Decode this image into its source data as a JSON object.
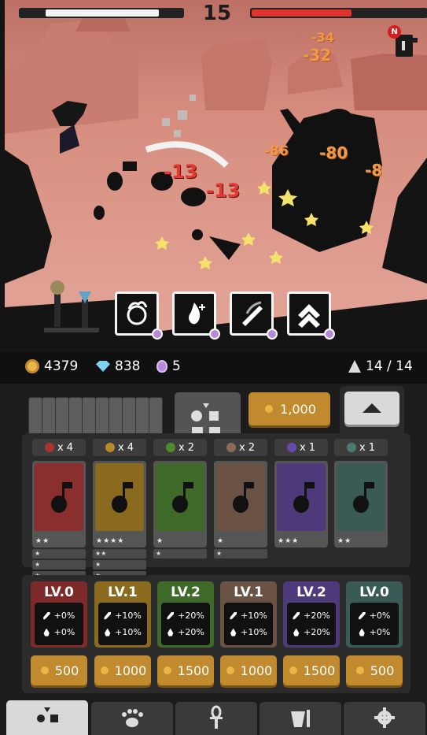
{
  "hud": {
    "wave_number": "15",
    "notification_badge": "N",
    "player_hp_fraction": 0.83,
    "enemy_hp_fraction": 0.57
  },
  "damage_numbers": [
    "-32",
    "-34",
    "-8",
    "-13",
    "-13",
    "-80"
  ],
  "skills": [
    {
      "icon": "fireball-icon"
    },
    {
      "icon": "flame-plus-icon"
    },
    {
      "icon": "sword-slash-icon"
    },
    {
      "icon": "double-arrow-up-icon"
    }
  ],
  "resources": {
    "gold": "4379",
    "gems": "838",
    "potions": "5",
    "population": "14 / 14"
  },
  "summon": {
    "buy_label": "1,000"
  },
  "units": [
    {
      "count": "x 4",
      "color": "#8a2e2e",
      "mark_color": "#a33",
      "stars": "★★",
      "extra_cards": [
        "★",
        "★",
        "★"
      ]
    },
    {
      "count": "x 4",
      "color": "#8a6a1e",
      "mark_color": "#b48a2a",
      "stars": "★★★★",
      "extra_cards": [
        "★★",
        "★",
        "★"
      ]
    },
    {
      "count": "x 2",
      "color": "#3f6a2a",
      "mark_color": "#4f8a2c",
      "stars": "★",
      "extra_cards": [
        "★"
      ]
    },
    {
      "count": "x 2",
      "color": "#6a5244",
      "mark_color": "#8a6a55",
      "stars": "★",
      "extra_cards": [
        "★"
      ]
    },
    {
      "count": "x 1",
      "color": "#4e3a7a",
      "mark_color": "#6a4aa8",
      "stars": "★★★",
      "extra_cards": []
    },
    {
      "count": "x 1",
      "color": "#3a5a55",
      "mark_color": "#4a7a72",
      "stars": "★★",
      "extra_cards": []
    }
  ],
  "upgrades": [
    {
      "level": "LV.0",
      "attack": "+0%",
      "hp": "+0%",
      "cost": "500",
      "color": "#7e2a2a"
    },
    {
      "level": "LV.1",
      "attack": "+10%",
      "hp": "+10%",
      "cost": "1000",
      "color": "#8a6a1e"
    },
    {
      "level": "LV.2",
      "attack": "+20%",
      "hp": "+20%",
      "cost": "1500",
      "color": "#3f6a2a"
    },
    {
      "level": "LV.1",
      "attack": "+10%",
      "hp": "+10%",
      "cost": "1000",
      "color": "#6a5244"
    },
    {
      "level": "LV.2",
      "attack": "+20%",
      "hp": "+20%",
      "cost": "1500",
      "color": "#4e3a7a"
    },
    {
      "level": "LV.0",
      "attack": "+0%",
      "hp": "+0%",
      "cost": "500",
      "color": "#3a5a55"
    }
  ],
  "tabs": [
    {
      "icon": "units-icon",
      "active": true
    },
    {
      "icon": "paw-icon",
      "active": false
    },
    {
      "icon": "ankh-icon",
      "active": false
    },
    {
      "icon": "forge-icon",
      "active": false
    },
    {
      "icon": "gear-icon",
      "active": false
    }
  ]
}
